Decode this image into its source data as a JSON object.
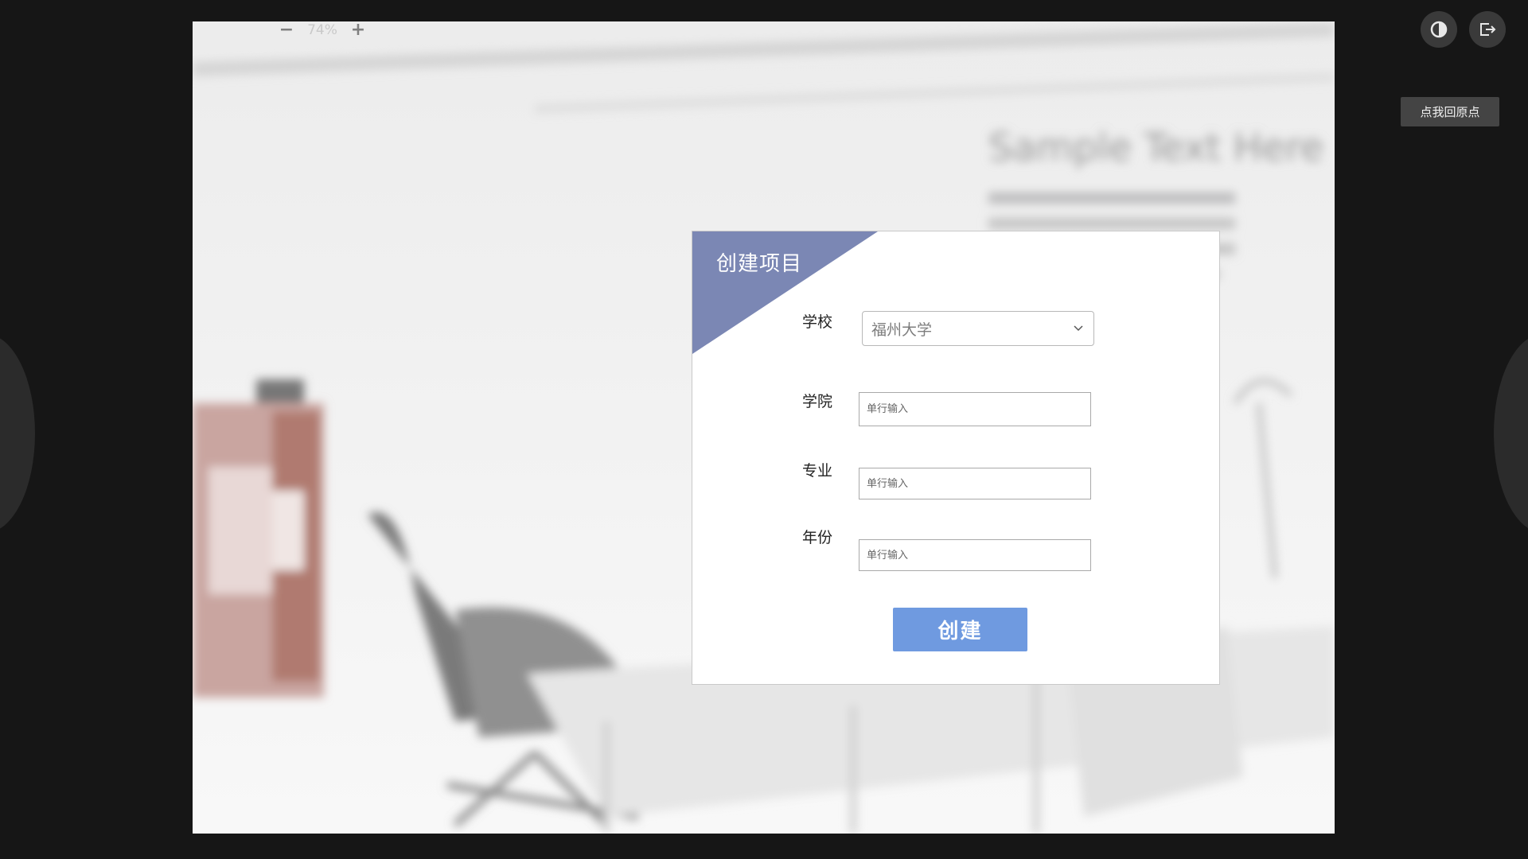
{
  "viewer": {
    "zoom_out_symbol": "−",
    "zoom_level": "74%",
    "zoom_in_symbol": "+",
    "contrast_icon": "contrast-icon",
    "exit_icon": "exit-icon",
    "reset_button_label": "点我回原点"
  },
  "background": {
    "heading": "Sample Text Here"
  },
  "dialog": {
    "title": "创建项目",
    "corner_color": "#7b87b4",
    "fields": {
      "school": {
        "label": "学校",
        "selected": "福州大学"
      },
      "college": {
        "label": "学院",
        "placeholder": "单行输入",
        "value": ""
      },
      "major": {
        "label": "专业",
        "placeholder": "单行输入",
        "value": ""
      },
      "year": {
        "label": "年份",
        "placeholder": "单行输入",
        "value": ""
      }
    },
    "submit_label": "创建",
    "submit_color": "#6f9ae0"
  }
}
